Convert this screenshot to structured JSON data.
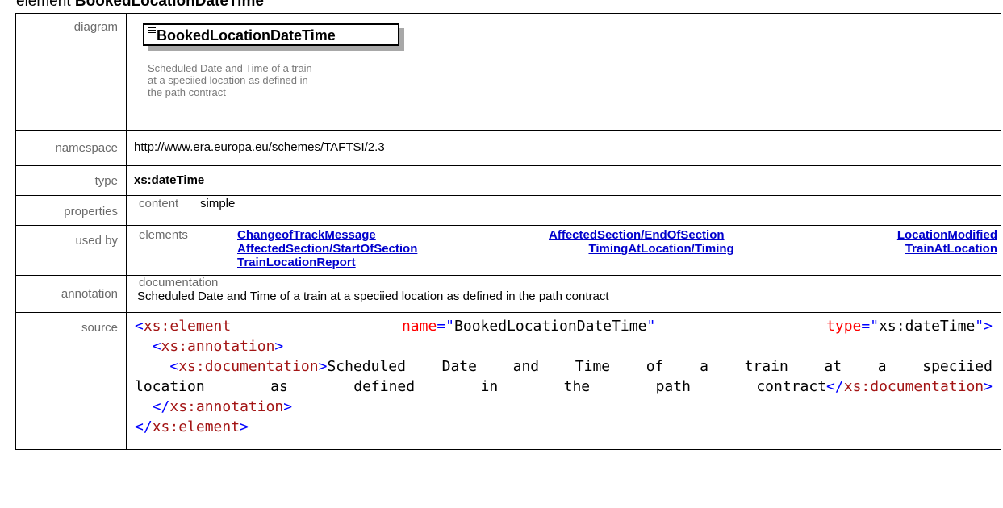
{
  "heading": {
    "prefix": "element",
    "name": "BookedLocationDateTime"
  },
  "rows": {
    "diagram": {
      "label": "diagram",
      "box_title": "BookedLocationDateTime",
      "description": "Scheduled Date and Time of a train at a speciied location as defined in the path contract",
      "desc_lines": [
        "Scheduled Date and Time of a train",
        "at a speciied location as defined in",
        "the path contract"
      ]
    },
    "namespace": {
      "label": "namespace",
      "value": "http://www.era.europa.eu/schemes/TAFTSI/2.3"
    },
    "type": {
      "label": "type",
      "value": "xs:dateTime"
    },
    "properties": {
      "label": "properties",
      "key": "content",
      "value": "simple"
    },
    "used_by": {
      "label": "used by",
      "key": "elements",
      "links": [
        [
          "ChangeofTrackMessage",
          "AffectedSection/EndOfSection",
          "LocationModified"
        ],
        [
          "AffectedSection/StartOfSection",
          "TimingAtLocation/Timing",
          "TrainAtLocation"
        ],
        [
          "TrainLocationReport"
        ]
      ]
    },
    "annotation": {
      "label": "annotation",
      "key": "documentation",
      "text": "Scheduled Date and Time of a train at a speciied location as defined in the path contract"
    },
    "source": {
      "label": "source",
      "line1": {
        "open": "<",
        "tag": "xs:element",
        "attr1": "name",
        "eq1": "=\"",
        "val1": "BookedLocationDateTime",
        "q1": "\"",
        "attr2": "type",
        "eq2": "=\"",
        "val2": "xs:dateTime",
        "close": "\">"
      },
      "line2": {
        "indent": "  ",
        "open": "<",
        "tag": "xs:annotation",
        "close": ">"
      },
      "line3": {
        "indent": "    ",
        "open": "<",
        "tag": "xs:documentation",
        "close": ">",
        "words": [
          "Scheduled",
          "Date",
          "and",
          "Time",
          "of",
          "a",
          "train",
          "at",
          "a",
          "speciied"
        ]
      },
      "line4": {
        "words": [
          "location",
          "as",
          "defined",
          "in",
          "the",
          "path"
        ],
        "last": "contract",
        "etag_open": "</",
        "etag": "xs:documentation",
        "etag_close": ">"
      },
      "line5": {
        "indent": "  ",
        "open": "</",
        "tag": "xs:annotation",
        "close": ">"
      },
      "line6": {
        "open": "</",
        "tag": "xs:element",
        "close": ">"
      }
    }
  }
}
